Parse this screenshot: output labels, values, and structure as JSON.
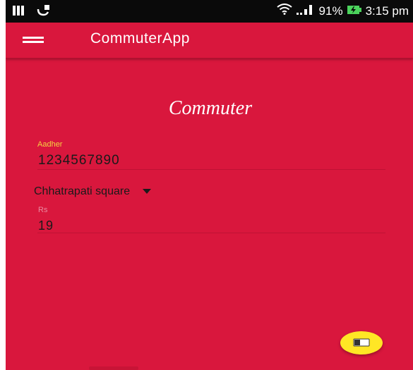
{
  "status_bar": {
    "battery": "91%",
    "time": "3:15 pm",
    "icons": [
      "sim-icon",
      "notification-icon",
      "wifi-icon",
      "signal-icon",
      "battery-charging-icon"
    ]
  },
  "app_bar": {
    "title": "CommuterApp",
    "menu_icon": "hamburger-menu-icon"
  },
  "logo": {
    "text": "Commuter"
  },
  "form": {
    "aadher": {
      "label": "Aadher",
      "value": "1234567890"
    },
    "station": {
      "selected": "Chhatrapati square"
    },
    "fare": {
      "label": "Rs",
      "value": "19"
    }
  },
  "fab": {
    "icon": "ticket-icon"
  },
  "colors": {
    "primary": "#d9173d",
    "accent": "#ffe625",
    "label_focus": "#f5d142"
  }
}
